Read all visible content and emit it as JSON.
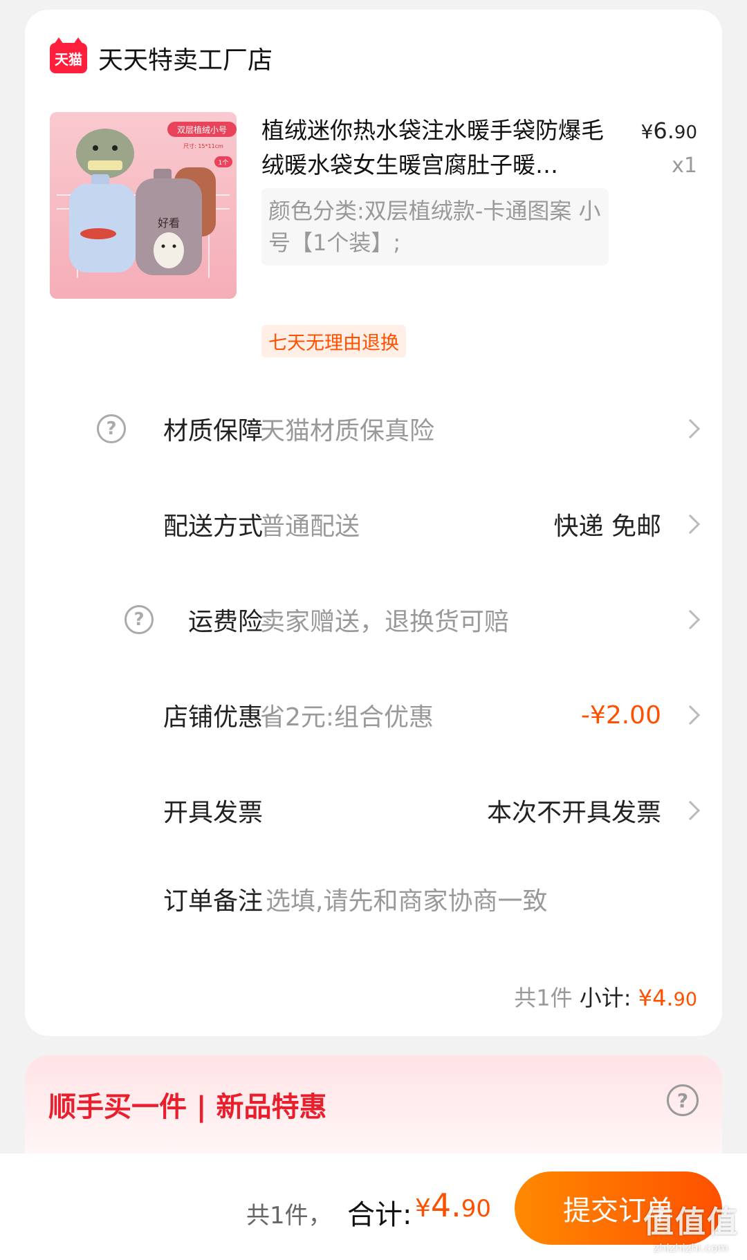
{
  "shop": {
    "logo_text": "天猫",
    "name": "天天特卖工厂店"
  },
  "product": {
    "title": "植绒迷你热水袋注水暖手袋防爆毛绒暖水袋女生暖宫腐肚子暖…",
    "price_symbol": "¥",
    "price_int": "6.",
    "price_dec": "90",
    "quantity": "x1",
    "sku": "颜色分类:双层植绒款-卡通图案 小号【1个装】;",
    "tag": "七天无理由退换",
    "image_text": {
      "badge": "双层植绒小号",
      "size": "尺寸: 15*11cm",
      "count": "1个",
      "bag_text": "好看"
    }
  },
  "rows": [
    {
      "id": "material",
      "label": "材质保障",
      "value": "天猫材质保真险",
      "right": "",
      "has_help": true,
      "has_chevron": true,
      "right_red": false
    },
    {
      "id": "delivery",
      "label": "配送方式",
      "value": "普通配送",
      "right": "快递 免邮",
      "has_help": false,
      "has_chevron": true,
      "right_red": false
    },
    {
      "id": "shipping-insurance",
      "label": "运费险",
      "value": "卖家赠送，退换货可赔",
      "right": "",
      "has_help": true,
      "has_chevron": true,
      "right_red": false
    },
    {
      "id": "store-discount",
      "label": "店铺优惠",
      "value": "省2元:组合优惠",
      "right": "-¥2.00",
      "has_help": false,
      "has_chevron": true,
      "right_red": true
    },
    {
      "id": "invoice",
      "label": "开具发票",
      "value": "",
      "right": "本次不开具发票",
      "has_help": false,
      "has_chevron": true,
      "right_red": false
    },
    {
      "id": "remark",
      "label": "订单备注",
      "value": "选填,请先和商家协商一致",
      "right": "",
      "has_help": false,
      "has_chevron": false,
      "right_red": false
    }
  ],
  "subtotal": {
    "count": "共1件",
    "label": "小计:",
    "symbol": "¥",
    "int": "4.",
    "dec": "90"
  },
  "promo": {
    "title": "顺手买一件 | 新品特惠",
    "help": "?"
  },
  "footer": {
    "count": "共1件，",
    "label": "合计:",
    "symbol": "¥",
    "int": "4.",
    "dec": "90",
    "submit_label": "提交订单"
  },
  "watermark": {
    "big": "值值值",
    "small": "zhizhizhi.com"
  },
  "colors": {
    "accent": "#ff5000",
    "tmall_red": "#ff1f3d",
    "promo_red": "#e81f2c"
  }
}
